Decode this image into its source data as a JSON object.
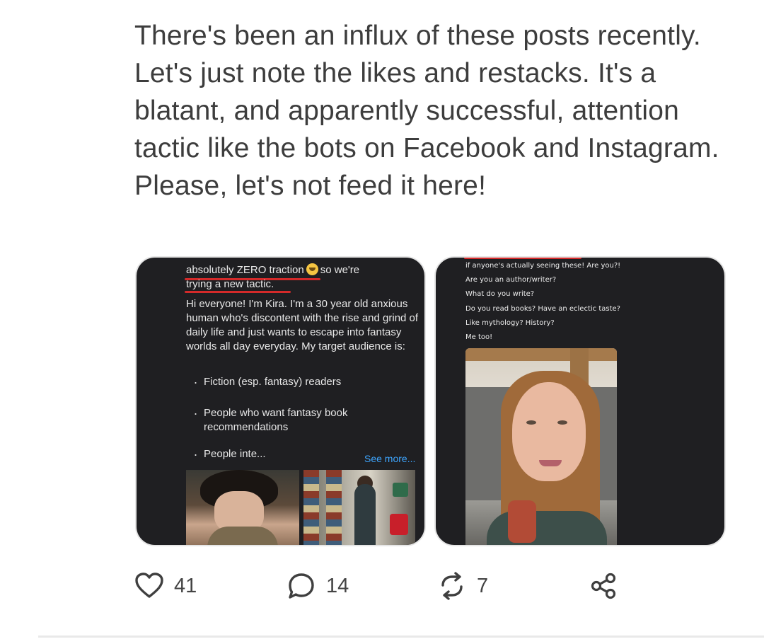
{
  "post": {
    "text": "There's been an influx of these posts recently. Let's just note the likes and restacks. It's a blatant, and apparently successful, attention tactic like the bots on Facebook and Instagram. Please, let's not feed it here!"
  },
  "left_card": {
    "line1a": "absolutely ZERO traction",
    "line1b": "so we're",
    "line2a": "trying a ",
    "line2b": "new tactic",
    "line2c": ".",
    "intro": "Hi everyone! I'm Kira. I'm a 30 year old anxious human who's discontent with the rise and grind of daily life and just wants to escape into fantasy worlds all day everyday. My target audience is:",
    "bullets": [
      "Fiction (esp. fantasy) readers",
      "People who want fantasy book recommendations",
      "People inte..."
    ],
    "see_more": "See more..."
  },
  "right_card": {
    "lines": [
      "if anyone's actually seeing these! Are you?!",
      "Are you an author/writer?",
      "What do you write?",
      "Do you read books? Have an eclectic taste?",
      "Like mythology? History?",
      "Me too!"
    ]
  },
  "actions": {
    "likes": "41",
    "comments": "14",
    "restacks": "7"
  },
  "colors": {
    "accent_link": "#3ea6ff",
    "highlight_underline": "#d42a2a",
    "card_bg": "#1f1f22"
  },
  "icons": {
    "like": "heart-icon",
    "comment": "comment-bubble-icon",
    "restack": "restack-arrows-icon",
    "share": "share-icon"
  }
}
